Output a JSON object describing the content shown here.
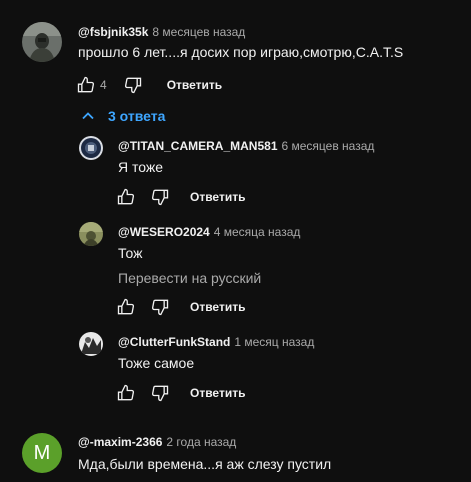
{
  "comments": [
    {
      "author": "@fsbjnik35k",
      "time": "8 месяцев назад",
      "text": "прошло 6 лет....я досих пор играю,смотрю,C.A.T.S",
      "likes": "4",
      "reply_label": "Ответить",
      "replies_toggle": "3 ответа"
    }
  ],
  "replies": [
    {
      "author": "@TITAN_CAMERA_MAN581",
      "time": "6 месяцев назад",
      "text": "Я тоже",
      "reply_label": "Ответить"
    },
    {
      "author": "@WESERO2024",
      "time": "4 месяца назад",
      "text": "Тож",
      "translate": "Перевести на русский",
      "reply_label": "Ответить"
    },
    {
      "author": "@ClutterFunkStand",
      "time": "1 месяц назад",
      "text": "Тоже самое",
      "reply_label": "Ответить"
    }
  ],
  "next_comment": {
    "author": "@-maxim-2366",
    "time": "2 года назад",
    "text": "Мда,были времена...я аж слезу пустил",
    "avatar_letter": "M",
    "avatar_color": "#5ba02a"
  },
  "colors": {
    "background": "#0f0f0f",
    "link": "#3ea6ff",
    "secondary_text": "#aaaaaa"
  }
}
